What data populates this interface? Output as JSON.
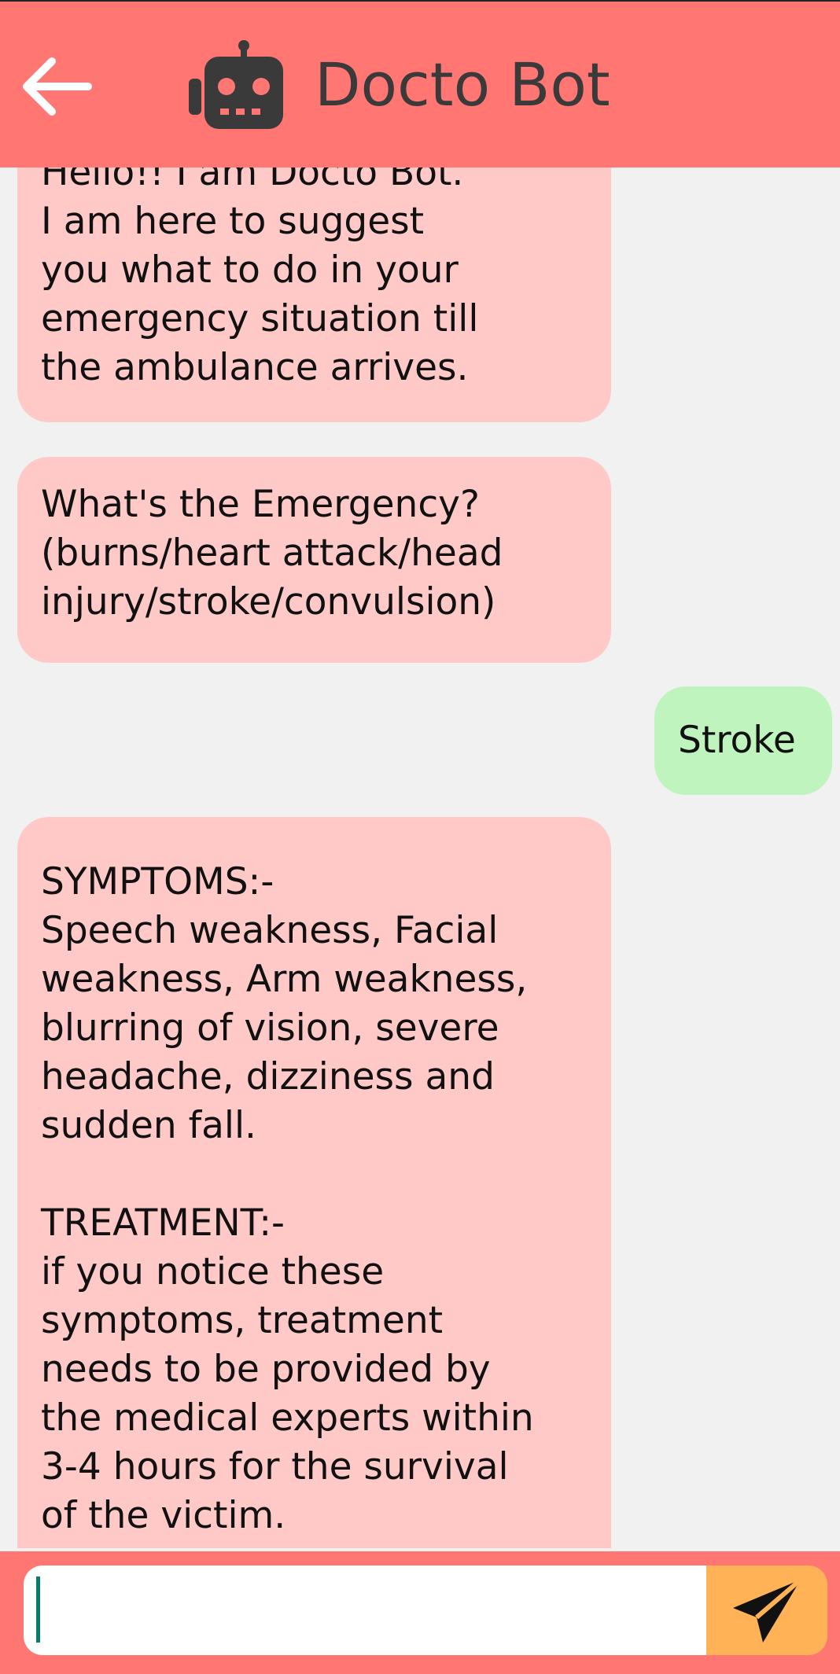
{
  "app": {
    "title": "Docto Bot",
    "colors": {
      "header": "#ff7673",
      "bot_bubble": "#ffc9c8",
      "user_bubble": "#c0f4be",
      "send_button": "#ffb256",
      "background": "#f1f1f1"
    }
  },
  "header": {
    "back_icon": "arrow-left-icon",
    "bot_icon": "robot-icon"
  },
  "messages": [
    {
      "sender": "bot",
      "text": "Hello!! I am Docto Bot.\nI am here to suggest\nyou what to do in your\nemergency situation till\nthe ambulance arrives."
    },
    {
      "sender": "bot",
      "text": "What's the Emergency?\n(burns/heart attack/head\ninjury/stroke/convulsion)"
    },
    {
      "sender": "user",
      "text": "Stroke"
    },
    {
      "sender": "bot",
      "text": "SYMPTOMS:-\nSpeech weakness, Facial\nweakness, Arm weakness,\nblurring of vision, severe\nheadache, dizziness and\nsudden fall.\n\nTREATMENT:-\nif you notice these\nsymptoms, treatment\nneeds to be provided by\nthe medical experts within\n3-4 hours for the survival\nof the victim."
    }
  ],
  "composer": {
    "value": "",
    "placeholder": "",
    "send_icon": "send-icon"
  }
}
